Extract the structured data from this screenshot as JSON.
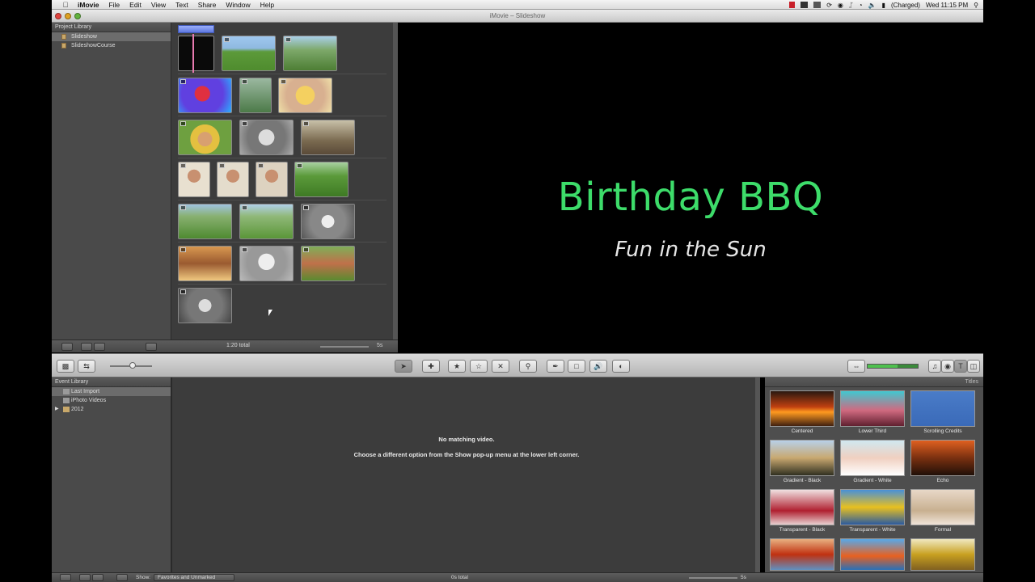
{
  "menubar": {
    "app": "iMovie",
    "items": [
      "File",
      "Edit",
      "View",
      "Text",
      "Share",
      "Window",
      "Help"
    ],
    "battery": "(Charged)",
    "clock": "Wed 11:15 PM"
  },
  "window": {
    "title": "iMovie – Slideshow"
  },
  "project_library": {
    "heading": "Project Library",
    "items": [
      "Slideshow",
      "SlideshowCourse"
    ]
  },
  "project_area": {
    "total": "1:20 total",
    "zoom_label": "5s"
  },
  "viewer": {
    "title": "Birthday BBQ",
    "subtitle": "Fun in the Sun"
  },
  "event_library": {
    "heading": "Event Library",
    "items": [
      "Last Import",
      "iPhoto Videos",
      "2012"
    ]
  },
  "event_area": {
    "message1": "No matching video.",
    "message2": "Choose a different option from the Show pop-up menu at the lower left corner."
  },
  "titles_panel": {
    "heading": "Titles",
    "items": [
      "Centered",
      "Lower Third",
      "Scrolling Credits",
      "Gradient - Black",
      "Gradient - White",
      "Echo",
      "Transparent - Black",
      "Transparent - White",
      "Formal"
    ]
  },
  "statusbar": {
    "show_label": "Show:",
    "show_value": "Favorites and Unmarked",
    "total": "0s total",
    "zoom_label": "5s"
  },
  "colors": {
    "title_green": "#3ddc6a",
    "selection": "#6c6c6c"
  }
}
